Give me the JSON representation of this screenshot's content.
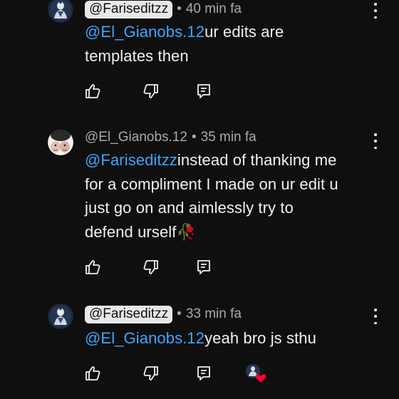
{
  "comments": [
    {
      "handle": "@Fariseditzz",
      "separator": "•",
      "time": "40 min fa",
      "mention": "@El_Gianobs.12",
      "line1_rest": "ur edits are",
      "line2": "templates then"
    },
    {
      "handle": "@El_Gianobs.12",
      "separator": "•",
      "time": "35 min fa",
      "mention": "@Fariseditzz",
      "line1_rest": "instead of thanking me",
      "line2": "for a compliment I made on ur edit u",
      "line3": "just go on and aimlessly try to",
      "line4": "defend urself",
      "emoji": "🥀"
    },
    {
      "handle": "@Fariseditzz",
      "separator": "•",
      "time": "33 min fa",
      "mention": "@El_Gianobs.12",
      "line1_rest": "yeah bro js sthu"
    }
  ],
  "icons": {
    "like": "thumb-up-icon",
    "dislike": "thumb-down-icon",
    "reply": "reply-icon",
    "menu": "more-vert-icon",
    "creator_heart": "creator-heart-icon"
  },
  "colors": {
    "background": "#0f0f0f",
    "text": "#f1f1f1",
    "secondary_text": "#aaaaaa",
    "mention": "#3ea6ff",
    "chip": "#e8e8e8",
    "heart": "#ff0033"
  }
}
